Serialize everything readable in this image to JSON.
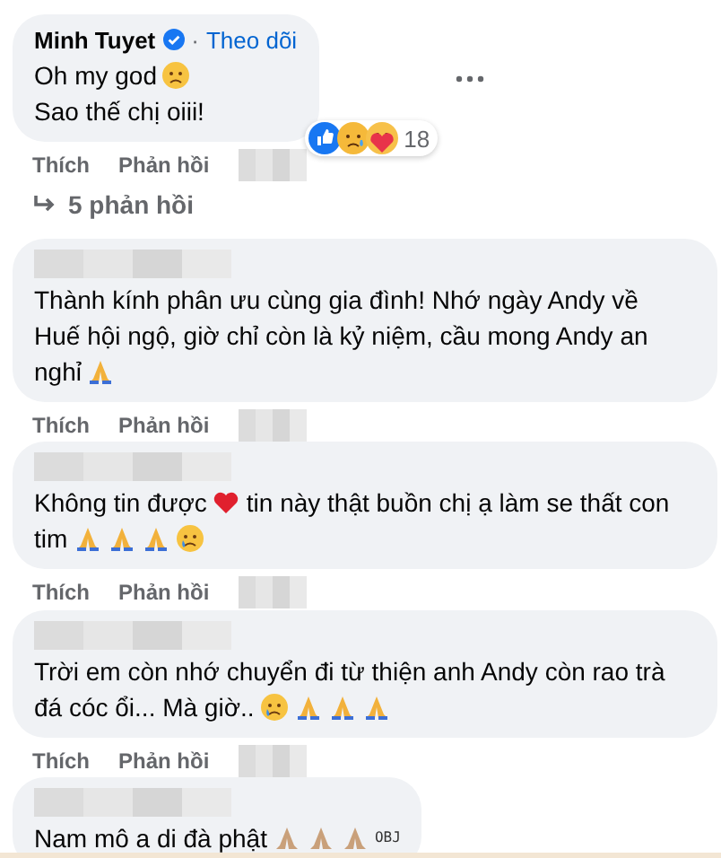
{
  "comments": [
    {
      "author": "Minh Tuyet",
      "verified": true,
      "separator": "·",
      "follow": "Theo dõi",
      "wide": false,
      "more": true,
      "lines": [
        [
          {
            "kind": "text",
            "text": "Oh my god"
          },
          {
            "kind": "sad"
          }
        ],
        [
          {
            "kind": "text",
            "text": "Sao thế chị oiii!"
          }
        ]
      ],
      "reactions": {
        "count": "18"
      },
      "actions": [
        "Thích",
        "Phản hồi"
      ],
      "replies": "5 phản hồi"
    },
    {
      "verified": false,
      "wide": true,
      "more": false,
      "lines": [
        [
          {
            "kind": "text",
            "text": "Thành kính phân ưu cùng gia đình! Nhớ ngày Andy về"
          }
        ],
        [
          {
            "kind": "text",
            "text": "Huế hội ngộ, giờ chỉ còn là kỷ niệm, cầu mong Andy an"
          }
        ],
        [
          {
            "kind": "text",
            "text": "nghỉ"
          },
          {
            "kind": "pray"
          }
        ]
      ],
      "actions": [
        "Thích",
        "Phản hồi"
      ]
    },
    {
      "verified": false,
      "wide": true,
      "more": false,
      "lines": [
        [
          {
            "kind": "text",
            "text": "Không tin được"
          },
          {
            "kind": "heart"
          },
          {
            "kind": "text",
            "text": "tin này thật buồn chị ạ làm se thất con"
          }
        ],
        [
          {
            "kind": "text",
            "text": "tim"
          },
          {
            "kind": "pray"
          },
          {
            "kind": "pray"
          },
          {
            "kind": "pray"
          },
          {
            "kind": "cry"
          }
        ]
      ],
      "actions": [
        "Thích",
        "Phản hồi"
      ]
    },
    {
      "verified": false,
      "wide": true,
      "more": false,
      "lines": [
        [
          {
            "kind": "text",
            "text": "Trời em còn nhớ chuyển đi từ thiện anh Andy còn rao trà"
          }
        ],
        [
          {
            "kind": "text",
            "text": "đá cóc ổi... Mà giờ.."
          },
          {
            "kind": "cry"
          },
          {
            "kind": "pray"
          },
          {
            "kind": "pray"
          },
          {
            "kind": "pray"
          }
        ]
      ],
      "actions": [
        "Thích",
        "Phản hồi"
      ]
    },
    {
      "verified": false,
      "wide": false,
      "more": false,
      "lines": [
        [
          {
            "kind": "text",
            "text": "Nam mô a di đà phật"
          },
          {
            "kind": "praytan"
          },
          {
            "kind": "praytan"
          },
          {
            "kind": "praytan"
          },
          {
            "kind": "obj",
            "text": "OBJ"
          }
        ]
      ]
    }
  ]
}
